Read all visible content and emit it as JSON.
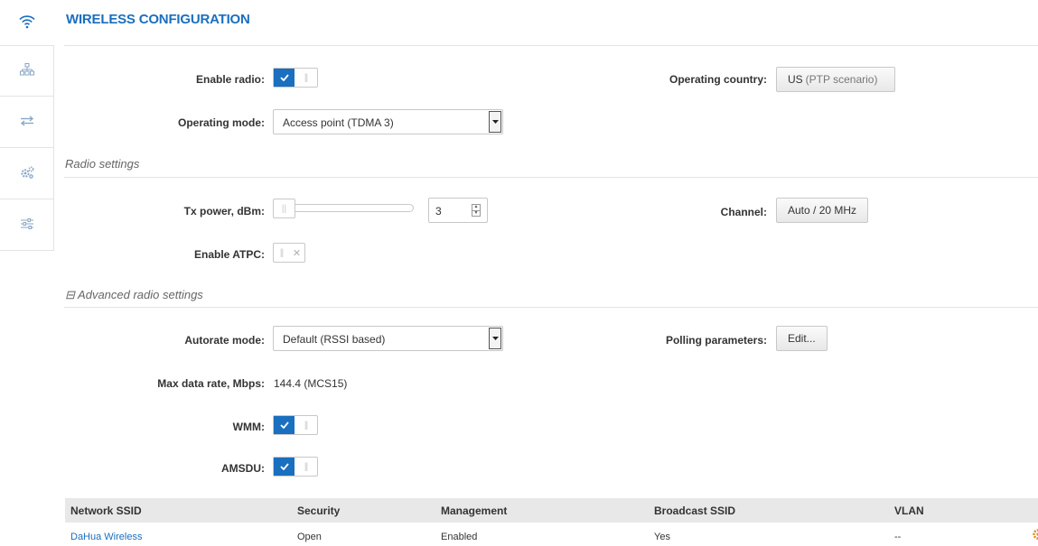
{
  "header": {
    "title": "WIRELESS CONFIGURATION"
  },
  "sidebar": {
    "top_icon": "wifi-icon",
    "items": [
      {
        "icon": "network-tree-icon"
      },
      {
        "icon": "transfer-arrows-icon"
      },
      {
        "icon": "gears-icon"
      },
      {
        "icon": "sliders-icon"
      }
    ]
  },
  "radio": {
    "enable_radio_label": "Enable radio:",
    "enable_radio_on": true,
    "operating_mode_label": "Operating mode:",
    "operating_mode_value": "Access point (TDMA 3)",
    "operating_country_label": "Operating country:",
    "operating_country_value": "US",
    "operating_country_suffix": "(PTP scenario)"
  },
  "radio_settings": {
    "title": "Radio settings",
    "tx_power_label": "Tx power, dBm:",
    "tx_power_value": "3",
    "channel_label": "Channel:",
    "channel_value": "Auto / 20 MHz",
    "enable_atpc_label": "Enable ATPC:",
    "enable_atpc_on": false
  },
  "advanced": {
    "title": "Advanced radio settings",
    "collapse_glyph": "⊟",
    "autorate_label": "Autorate mode:",
    "autorate_value": "Default (RSSI based)",
    "polling_label": "Polling parameters:",
    "polling_button": "Edit...",
    "max_rate_label": "Max data rate, Mbps:",
    "max_rate_value": "144.4 (MCS15)",
    "wmm_label": "WMM:",
    "wmm_on": true,
    "amsdu_label": "AMSDU:",
    "amsdu_on": true
  },
  "ssid_table": {
    "columns": [
      "Network SSID",
      "Security",
      "Management",
      "Broadcast SSID",
      "VLAN"
    ],
    "rows": [
      [
        "DaHua Wireless",
        "Open",
        "Enabled",
        "Yes",
        "--"
      ]
    ]
  },
  "colors": {
    "accent": "#1a6fbf",
    "table_header_bg": "#e8e8e8",
    "gear_action": "#e08a1e"
  }
}
